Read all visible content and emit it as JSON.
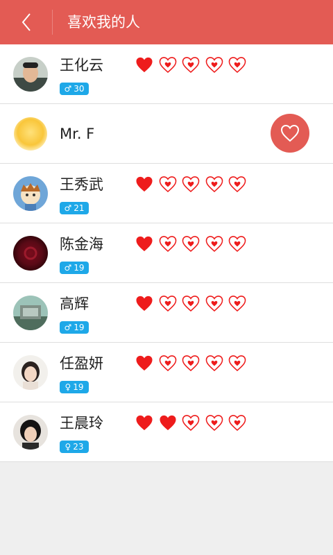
{
  "header": {
    "title": "喜欢我的人",
    "back_icon": "chevron-left-icon"
  },
  "colors": {
    "header": "#e35b54",
    "badge": "#1ea8e8",
    "heart": "#ee1c1c"
  },
  "people": [
    {
      "name": "王化云",
      "gender": "male",
      "gender_symbol": "♂",
      "age": "30",
      "hearts_filled": 1,
      "hearts_total": 5
    },
    {
      "name": "Mr. F",
      "like_button_icon": "heart-outline-icon"
    },
    {
      "name": "王秀武",
      "gender": "male",
      "gender_symbol": "♂",
      "age": "21",
      "hearts_filled": 1,
      "hearts_total": 5
    },
    {
      "name": "陈金海",
      "gender": "male",
      "gender_symbol": "♂",
      "age": "19",
      "hearts_filled": 1,
      "hearts_total": 5
    },
    {
      "name": "高辉",
      "gender": "male",
      "gender_symbol": "♂",
      "age": "19",
      "hearts_filled": 1,
      "hearts_total": 5
    },
    {
      "name": "任盈妍",
      "gender": "female",
      "gender_symbol": "♀",
      "age": "19",
      "hearts_filled": 1,
      "hearts_total": 5
    },
    {
      "name": "王晨玲",
      "gender": "female",
      "gender_symbol": "♀",
      "age": "23",
      "hearts_filled": 2,
      "hearts_total": 5
    }
  ]
}
